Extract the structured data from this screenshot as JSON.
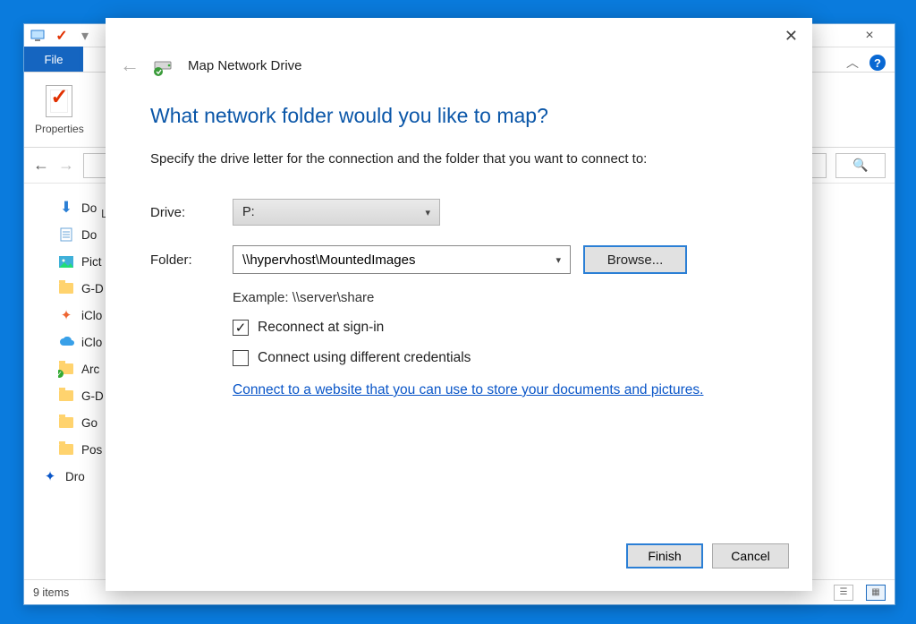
{
  "explorer": {
    "file_tab": "File",
    "properties_label": "Properties",
    "location_prefix": "Lo",
    "close_label": "×",
    "search_placeholder": "",
    "status_items": "9 items",
    "sidebar": [
      {
        "label": "Do",
        "icon": "download",
        "color": "#2b7fd5"
      },
      {
        "label": "Do",
        "icon": "document",
        "color": "#555"
      },
      {
        "label": "Pict",
        "icon": "picture",
        "color": "#4aa"
      },
      {
        "label": "G-D",
        "icon": "folder-user",
        "color": "#f0c040"
      },
      {
        "label": "iClo",
        "icon": "flower",
        "color": "#e63"
      },
      {
        "label": "iClo",
        "icon": "cloud",
        "color": "#39a0e8"
      },
      {
        "label": "Arc",
        "icon": "folder-check",
        "color": "#f0c040"
      },
      {
        "label": "G-D",
        "icon": "folder-user",
        "color": "#f0c040"
      },
      {
        "label": "Go",
        "icon": "folder-user",
        "color": "#f0c040"
      },
      {
        "label": "Pos",
        "icon": "folder-user",
        "color": "#f0c040"
      },
      {
        "label": "Dro",
        "icon": "dropbox",
        "color": "#0a56c8"
      }
    ]
  },
  "dialog": {
    "header_title": "Map Network Drive",
    "question": "What network folder would you like to map?",
    "instructions": "Specify the drive letter for the connection and the folder that you want to connect to:",
    "drive_label": "Drive:",
    "drive_value": "P:",
    "folder_label": "Folder:",
    "folder_value": "\\\\hypervhost\\MountedImages",
    "browse_label": "Browse...",
    "example_text": "Example: \\\\server\\share",
    "reconnect_label": "Reconnect at sign-in",
    "reconnect_checked": true,
    "diff_creds_label": "Connect using different credentials",
    "diff_creds_checked": false,
    "hyperlink_text": "Connect to a website that you can use to store your documents and pictures",
    "finish_label": "Finish",
    "cancel_label": "Cancel"
  }
}
